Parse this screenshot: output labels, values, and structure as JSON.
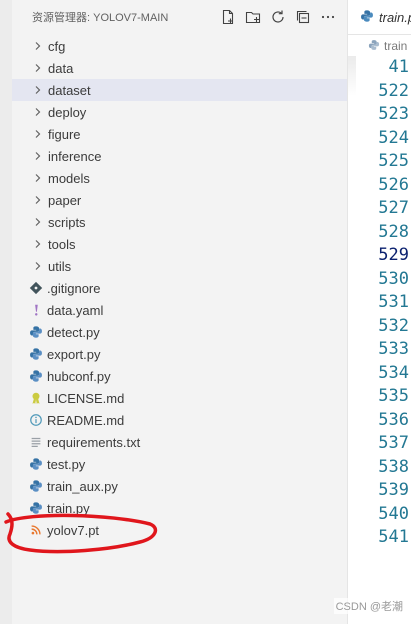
{
  "explorer": {
    "title": "资源管理器: YOLOV7-MAIN",
    "actions": [
      {
        "name": "new-file-icon"
      },
      {
        "name": "new-folder-icon"
      },
      {
        "name": "refresh-icon"
      },
      {
        "name": "collapse-all-icon"
      },
      {
        "name": "more-actions-icon",
        "label": "···"
      }
    ],
    "folders": [
      {
        "label": "cfg",
        "selected": false
      },
      {
        "label": "data",
        "selected": false
      },
      {
        "label": "dataset",
        "selected": true
      },
      {
        "label": "deploy",
        "selected": false
      },
      {
        "label": "figure",
        "selected": false
      },
      {
        "label": "inference",
        "selected": false
      },
      {
        "label": "models",
        "selected": false
      },
      {
        "label": "paper",
        "selected": false
      },
      {
        "label": "scripts",
        "selected": false
      },
      {
        "label": "tools",
        "selected": false
      },
      {
        "label": "utils",
        "selected": false
      }
    ],
    "files": [
      {
        "label": ".gitignore",
        "icon": "git-icon"
      },
      {
        "label": "data.yaml",
        "icon": "yaml-icon"
      },
      {
        "label": "detect.py",
        "icon": "python-icon"
      },
      {
        "label": "export.py",
        "icon": "python-icon"
      },
      {
        "label": "hubconf.py",
        "icon": "python-icon"
      },
      {
        "label": "LICENSE.md",
        "icon": "license-icon"
      },
      {
        "label": "README.md",
        "icon": "info-icon"
      },
      {
        "label": "requirements.txt",
        "icon": "text-file-icon"
      },
      {
        "label": "test.py",
        "icon": "python-icon"
      },
      {
        "label": "train_aux.py",
        "icon": "python-icon"
      },
      {
        "label": "train.py",
        "icon": "python-icon"
      },
      {
        "label": "yolov7.pt",
        "icon": "rss-icon"
      }
    ]
  },
  "editor": {
    "tab_label": "train.p",
    "breadcrumb": "train",
    "line_numbers": [
      "41",
      "522",
      "523",
      "524",
      "525",
      "526",
      "527",
      "528",
      "529",
      "530",
      "531",
      "532",
      "533",
      "534",
      "535",
      "536",
      "537",
      "538",
      "539",
      "540",
      "541"
    ],
    "current_line": "529"
  },
  "watermark": "CSDN @老潮",
  "colors": {
    "accent": "#0b216f",
    "line_number": "#237893",
    "selection": "#e4e6f1",
    "annotation": "#e0161c",
    "python": "#3572a5",
    "rss": "#e8772e"
  }
}
